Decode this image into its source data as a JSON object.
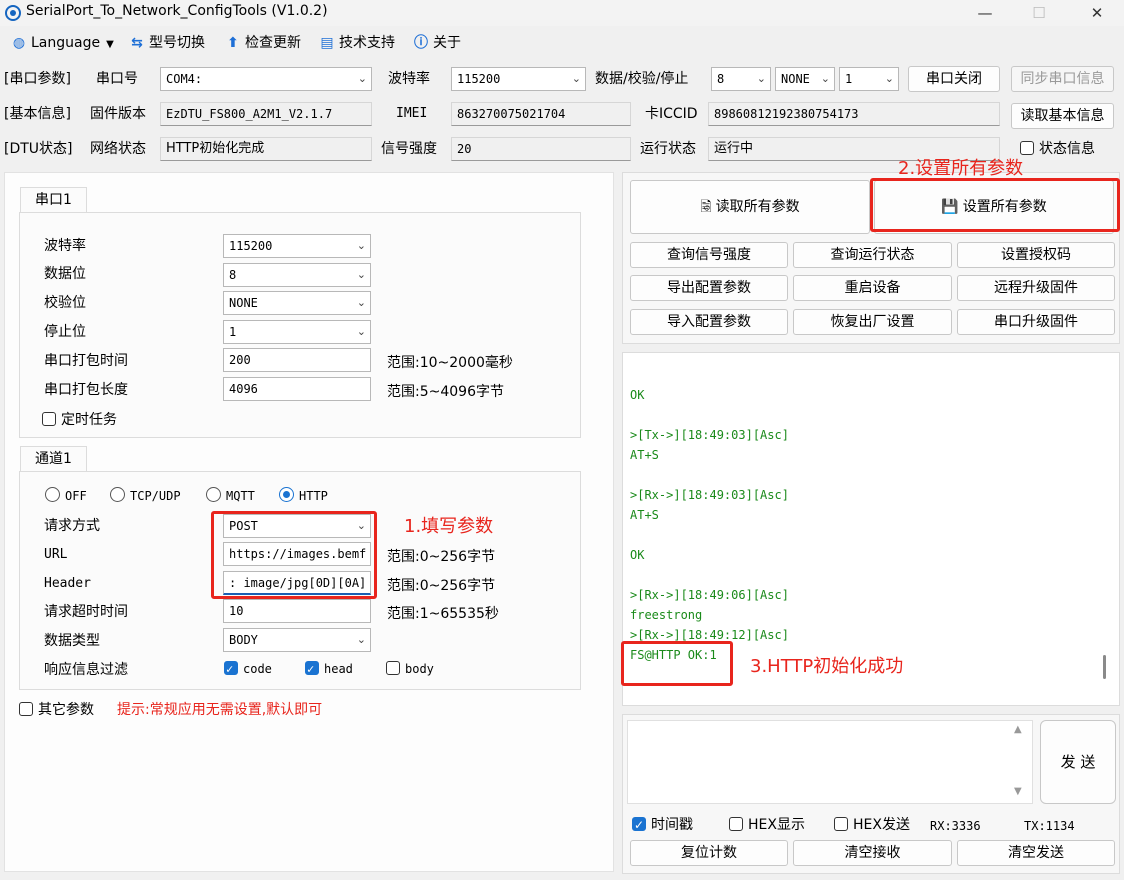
{
  "window": {
    "title": "SerialPort_To_Network_ConfigTools (V1.0.2)",
    "minimize": "—",
    "maximize": "☐",
    "close": "✕"
  },
  "menu": [
    {
      "icon": "globe-icon",
      "glyph": "◍",
      "label": "Language"
    },
    {
      "icon": "switch-icon",
      "glyph": "⇆",
      "label": "型号切换"
    },
    {
      "icon": "upload-arrow-icon",
      "glyph": "⬆",
      "label": "检查更新"
    },
    {
      "icon": "document-icon",
      "glyph": "▤",
      "label": "技术支持"
    },
    {
      "icon": "info-icon",
      "glyph": "ⓘ",
      "label": "关于"
    }
  ],
  "serial": {
    "section": "[串口参数]",
    "port_label": "串口号",
    "port_value": "COM4:",
    "baud_label": "波特率",
    "baud_value": "115200",
    "dps_label": "数据/校验/停止",
    "data_bits": "8",
    "parity": "NONE",
    "stop_bits": "1",
    "close_button": "串口关闭",
    "sync_button": "同步串口信息"
  },
  "basic": {
    "section": "[基本信息]",
    "fw_label": "固件版本",
    "fw_value": "EzDTU_FS800_A2M1_V2.1.7",
    "imei_label": "IMEI",
    "imei_value": "863270075021704",
    "iccid_label": "卡ICCID",
    "iccid_value": "89860812192380754173",
    "read_button": "读取基本信息"
  },
  "status": {
    "section": "[DTU状态]",
    "net_label": "网络状态",
    "net_value": "HTTP初始化完成",
    "signal_label": "信号强度",
    "signal_value": "20",
    "run_label": "运行状态",
    "run_value": "运行中",
    "status_info_label": "状态信息"
  },
  "port_tab": {
    "tab": "串口1",
    "baud_label": "波特率",
    "baud_value": "115200",
    "data_label": "数据位",
    "data_value": "8",
    "parity_label": "校验位",
    "parity_value": "NONE",
    "stop_label": "停止位",
    "stop_value": "1",
    "pack_time_label": "串口打包时间",
    "pack_time_value": "200",
    "pack_time_range": "范围:10~2000毫秒",
    "pack_len_label": "串口打包长度",
    "pack_len_value": "4096",
    "pack_len_range": "范围:5~4096字节",
    "timer_label": "定时任务"
  },
  "channel_tab": {
    "tab": "通道1",
    "modes": [
      "OFF",
      "TCP/UDP",
      "MQTT",
      "HTTP"
    ],
    "method_label": "请求方式",
    "method_value": "POST",
    "url_label": "URL",
    "url_value": "https://images.bemf",
    "url_range": "范围:0~256字节",
    "header_label": "Header",
    "header_value": ": image/jpg[0D][0A]",
    "header_range": "范围:0~256字节",
    "timeout_label": "请求超时时间",
    "timeout_value": "10",
    "timeout_range": "范围:1~65535秒",
    "dtype_label": "数据类型",
    "dtype_value": "BODY",
    "filter_label": "响应信息过滤",
    "filter_code": "code",
    "filter_head": "head",
    "filter_body": "body"
  },
  "other": {
    "label": "其它参数",
    "hint": "提示:常规应用无需设置,默认即可"
  },
  "actions": {
    "read_all": "读取所有参数",
    "set_all": "设置所有参数",
    "q_signal": "查询信号强度",
    "q_run": "查询运行状态",
    "set_auth": "设置授权码",
    "export": "导出配置参数",
    "reboot": "重启设备",
    "remote_upgrade": "远程升级固件",
    "import": "导入配置参数",
    "factory": "恢复出厂设置",
    "serial_upgrade": "串口升级固件"
  },
  "log": [
    "OK",
    ">[Tx->][18:49:03][Asc]",
    "AT+S",
    ">[Rx->][18:49:03][Asc]",
    "AT+S",
    "OK",
    ">[Rx->][18:49:06][Asc]",
    "freestrong",
    ">[Rx->][18:49:12][Asc]",
    "FS@HTTP OK:1"
  ],
  "send": {
    "send_button": "发 送",
    "timestamp_label": "时间戳",
    "hex_show_label": "HEX显示",
    "hex_send_label": "HEX发送",
    "rx": "RX:3336",
    "tx": "TX:1134",
    "reset_count": "复位计数",
    "clear_rx": "清空接收",
    "clear_tx": "清空发送"
  },
  "annotations": {
    "step1": "1.填写参数",
    "step2": "2.设置所有参数",
    "step3": "3.HTTP初始化成功",
    "color": "#e8251d"
  },
  "colors": {
    "accent": "#1a73d1",
    "log_text": "#1a8a1a"
  }
}
